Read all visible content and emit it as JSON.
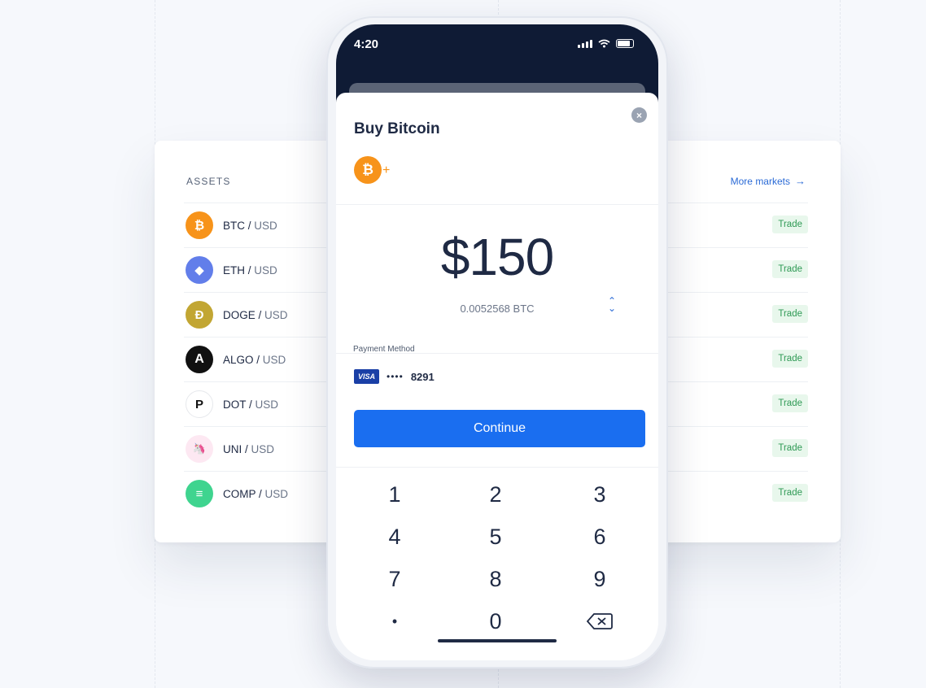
{
  "assets_card": {
    "heading": "ASSETS",
    "more_markets": "More markets",
    "rows": [
      {
        "base": "BTC",
        "quote": "USD",
        "trade": "Trade",
        "icon": "bitcoin-icon",
        "glyph": "₿",
        "color": "#f7931a"
      },
      {
        "base": "ETH",
        "quote": "USD",
        "trade": "Trade",
        "icon": "ethereum-icon",
        "glyph": "◆",
        "color": "#627eea"
      },
      {
        "base": "DOGE",
        "quote": "USD",
        "trade": "Trade",
        "icon": "dogecoin-icon",
        "glyph": "Ð",
        "color": "#c2a633"
      },
      {
        "base": "ALGO",
        "quote": "USD",
        "trade": "Trade",
        "icon": "algorand-icon",
        "glyph": "A",
        "color": "#111111"
      },
      {
        "base": "DOT",
        "quote": "USD",
        "trade": "Trade",
        "icon": "polkadot-icon",
        "glyph": "P",
        "color": "#ffffff"
      },
      {
        "base": "UNI",
        "quote": "USD",
        "trade": "Trade",
        "icon": "uniswap-icon",
        "glyph": "🦄",
        "color": "#fde8f2"
      },
      {
        "base": "COMP",
        "quote": "USD",
        "trade": "Trade",
        "icon": "compound-icon",
        "glyph": "≡",
        "color": "#3fd48f"
      }
    ]
  },
  "phone": {
    "time": "4:20",
    "sheet": {
      "title": "Buy Bitcoin",
      "amount": "$150",
      "btc_amount": "0.0052568 BTC",
      "payment_method_label": "Payment Method",
      "card_brand": "VISA",
      "card_mask": "••••",
      "card_last4": "8291",
      "continue_label": "Continue"
    },
    "keypad": [
      "1",
      "2",
      "3",
      "4",
      "5",
      "6",
      "7",
      "8",
      "9",
      "•",
      "0",
      "⌫"
    ]
  }
}
